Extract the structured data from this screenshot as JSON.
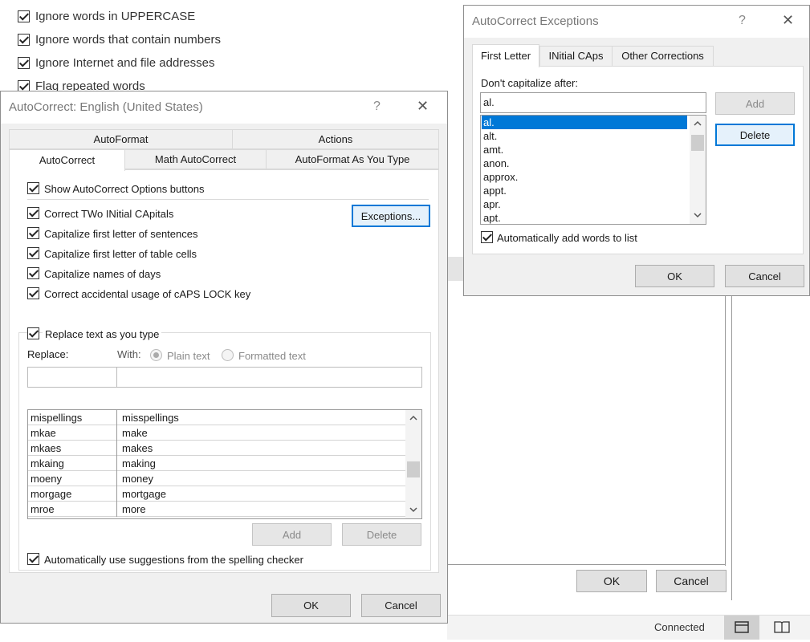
{
  "background_options": [
    {
      "label": "Ignore words in UPPERCASE",
      "checked": true
    },
    {
      "label": "Ignore words that contain numbers",
      "checked": true
    },
    {
      "label": "Ignore Internet and file addresses",
      "checked": true
    },
    {
      "label": "Flag repeated words",
      "checked": true
    }
  ],
  "bg_dialog": {
    "ok_label": "OK",
    "cancel_label": "Cancel"
  },
  "status_bar": {
    "status_text": "Connected"
  },
  "autocorrect_dialog": {
    "title": "AutoCorrect: English (United States)",
    "help": "?",
    "close": "✕",
    "tabs_row1": [
      "AutoFormat",
      "Actions"
    ],
    "tabs_row2": [
      "AutoCorrect",
      "Math AutoCorrect",
      "AutoFormat As You Type"
    ],
    "show_options": "Show AutoCorrect Options buttons",
    "options": [
      "Correct TWo INitial CApitals",
      "Capitalize first letter of sentences",
      "Capitalize first letter of table cells",
      "Capitalize names of days",
      "Correct accidental usage of cAPS LOCK key"
    ],
    "exceptions_button": "Exceptions...",
    "replace_text": "Replace text as you type",
    "replace_label": "Replace:",
    "with_label": "With:",
    "plain_text": "Plain text",
    "formatted_text": "Formatted text",
    "replace_value": "",
    "with_value": "",
    "entries": [
      [
        "mispellings",
        "misspellings"
      ],
      [
        "mkae",
        "make"
      ],
      [
        "mkaes",
        "makes"
      ],
      [
        "mkaing",
        "making"
      ],
      [
        "moeny",
        "money"
      ],
      [
        "morgage",
        "mortgage"
      ],
      [
        "mroe",
        "more"
      ]
    ],
    "add_label": "Add",
    "delete_label": "Delete",
    "suggestions": "Automatically use suggestions from the spelling checker",
    "ok_label": "OK",
    "cancel_label": "Cancel"
  },
  "exceptions_dialog": {
    "title": "AutoCorrect Exceptions",
    "help": "?",
    "close": "✕",
    "tabs": [
      "First Letter",
      "INitial CAps",
      "Other Corrections"
    ],
    "dont_cap": "Don't capitalize after:",
    "input_value": "al.",
    "list": [
      "al.",
      "alt.",
      "amt.",
      "anon.",
      "approx.",
      "appt.",
      "apr.",
      "apt."
    ],
    "add_label": "Add",
    "delete_label": "Delete",
    "auto_add": "Automatically add words to list",
    "ok_label": "OK",
    "cancel_label": "Cancel"
  },
  "colors": {
    "accent": "#0078d7",
    "selection": "#0078d7"
  }
}
